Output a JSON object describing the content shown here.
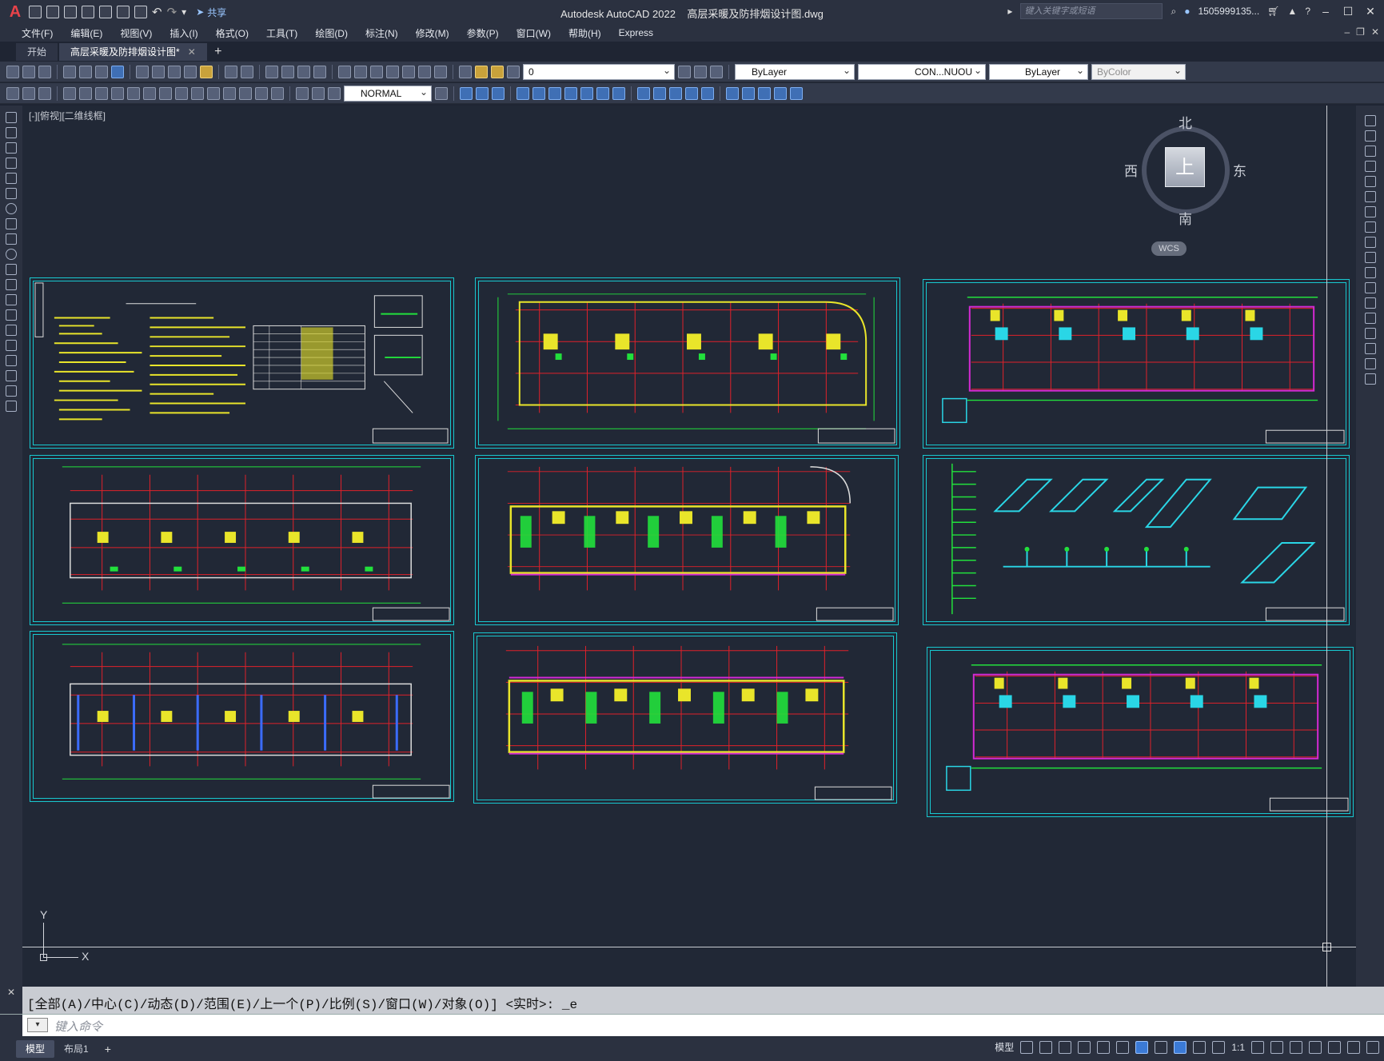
{
  "titlebar": {
    "app": "Autodesk AutoCAD 2022",
    "file": "高层采暖及防排烟设计图.dwg",
    "share": "共享",
    "search_placeholder": "键入关键字或短语",
    "user": "1505999135...",
    "icons": [
      "autocad-logo",
      "new-icon",
      "open-icon",
      "save-icon",
      "saveas-icon",
      "print-icon",
      "undo-icon",
      "redo-icon"
    ]
  },
  "menus": [
    "文件(F)",
    "编辑(E)",
    "视图(V)",
    "插入(I)",
    "格式(O)",
    "工具(T)",
    "绘图(D)",
    "标注(N)",
    "修改(M)",
    "参数(P)",
    "窗口(W)",
    "帮助(H)",
    "Express"
  ],
  "tabs": [
    {
      "label": "开始",
      "active": false
    },
    {
      "label": "高层采暖及防排烟设计图*",
      "active": true
    }
  ],
  "toolbar": {
    "layer": "0",
    "color": "ByLayer",
    "linetype": "CON...NUOU",
    "lineweight": "ByLayer",
    "plotstyle": "ByColor",
    "dimstyle": "NORMAL"
  },
  "viewport": {
    "label": "[-][俯视][二维线框]",
    "compass": {
      "north": "北",
      "south": "南",
      "west": "西",
      "east": "东",
      "top": "上"
    },
    "wcs": "WCS",
    "ucs_x": "X",
    "ucs_y": "Y"
  },
  "command": {
    "history": "[全部(A)/中心(C)/动态(D)/范围(E)/上一个(P)/比例(S)/窗口(W)/对象(O)] <实时>: _e",
    "placeholder": "键入命令"
  },
  "status": {
    "layout_tabs": [
      "模型",
      "布局1"
    ],
    "model_label": "模型",
    "scale": "1:1"
  },
  "colors": {
    "canvas": "#212836",
    "frame": "#18c8d0",
    "wall": "#e0212a",
    "green": "#22e03c",
    "yellow": "#e9e52a",
    "magenta": "#d52ad4",
    "cyan": "#2ad6e6"
  }
}
